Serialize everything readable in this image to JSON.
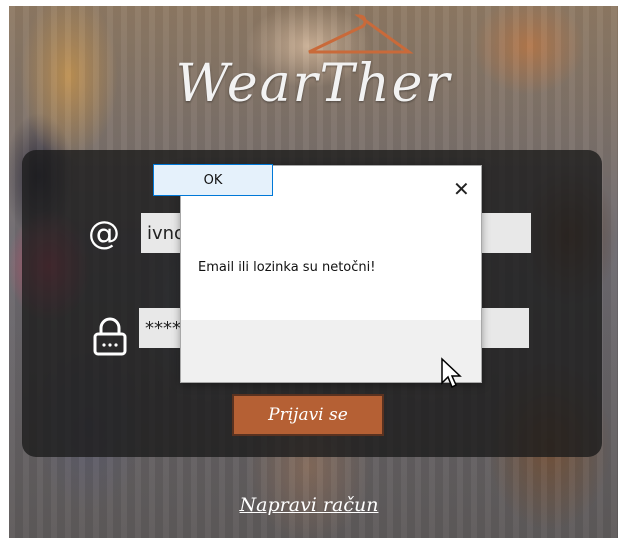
{
  "app": {
    "logo_text": "WearTher",
    "email_value": "ivno",
    "password_value": "*****",
    "login_label": "Prijavi se",
    "register_label": "Napravi račun"
  },
  "dialog": {
    "close_glyph": "✕",
    "message": "Email ili lozinka su netočni!",
    "ok_label": "OK"
  },
  "icons": {
    "email": "at-icon",
    "password": "lock-icon",
    "cursor": "arrow-pointer-icon"
  },
  "colors": {
    "accent_button": "#b56034",
    "panel": "#191919",
    "dialog_button_border": "#0078d7"
  }
}
